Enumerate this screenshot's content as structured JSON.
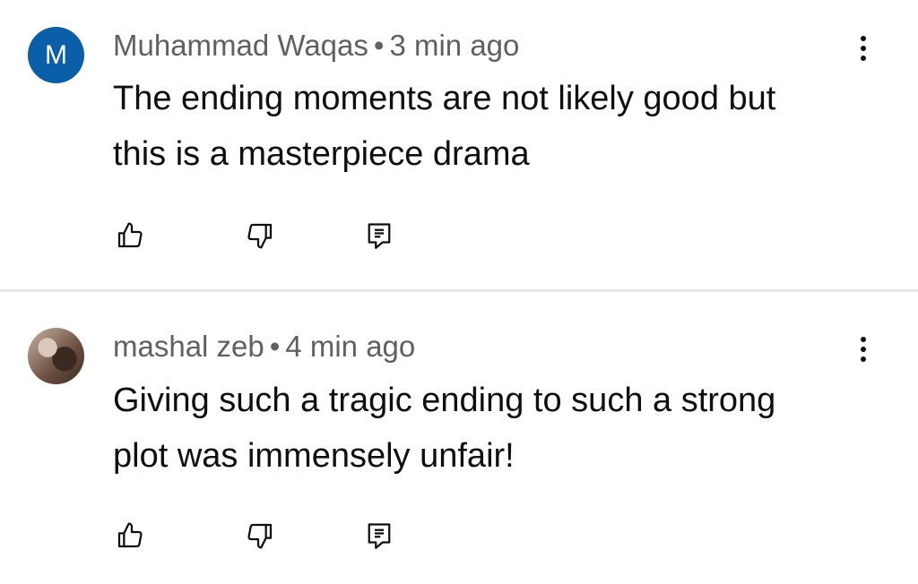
{
  "comments": [
    {
      "avatar_letter": "M",
      "author": "Muhammad Waqas",
      "separator": "•",
      "time": "3 min ago",
      "text": "The ending moments are not likely good but this is a masterpiece drama",
      "icons": [
        "like-icon",
        "dislike-icon",
        "reply-icon",
        "more-vert-icon"
      ],
      "avatar_color": "#0b5fa8"
    },
    {
      "author": "mashal zeb",
      "separator": "•",
      "time": "4 min ago",
      "text": "Giving such a tragic ending to such a strong plot was immensely unfair!",
      "icons": [
        "like-icon",
        "dislike-icon",
        "reply-icon",
        "more-vert-icon"
      ]
    }
  ]
}
